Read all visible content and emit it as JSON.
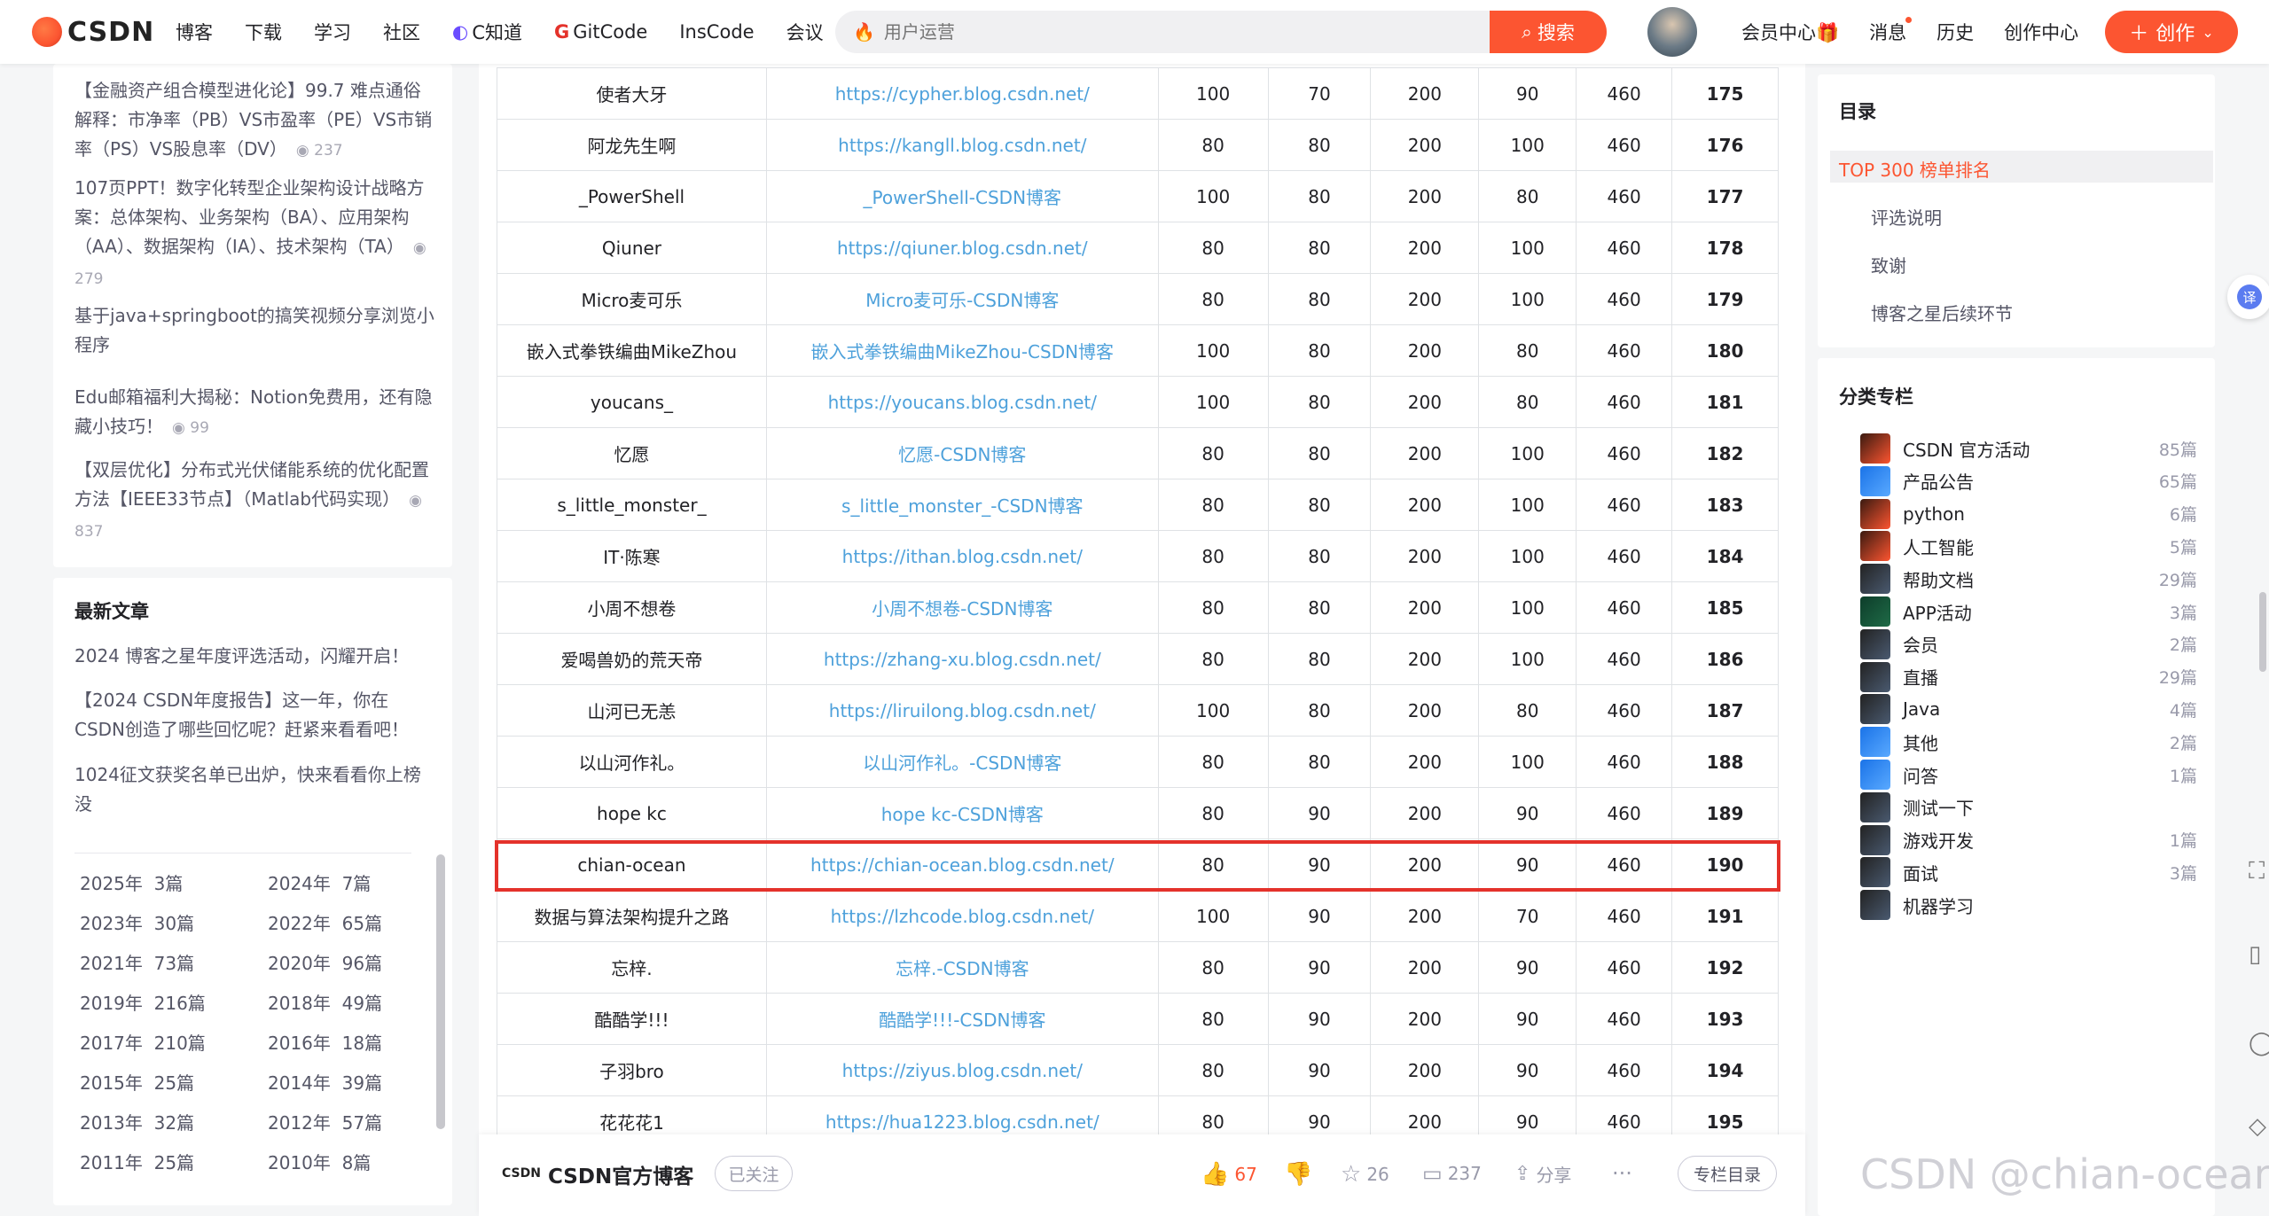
{
  "nav": {
    "logo_text": "CSDN",
    "items": [
      "博客",
      "下载",
      "学习",
      "社区",
      "C知道",
      "GitCode",
      "InsCode",
      "会议"
    ],
    "search_placeholder": "用户运营",
    "search_button": "搜索",
    "right": [
      "会员中心",
      "消息",
      "历史",
      "创作中心"
    ],
    "create": "创作"
  },
  "left": {
    "related": [
      {
        "title": "【金融资产组合模型进化论】99.7 难点通俗解释：市净率（PB）VS市盈率（PE）VS市销率（PS）VS股息率（DV）",
        "views": "237"
      },
      {
        "title": "107页PPT！数字化转型企业架构设计战略方案：总体架构、业务架构（BA）、应用架构（AA）、数据架构（IA）、技术架构（TA）",
        "views": "279"
      },
      {
        "title": "基于java+springboot的搞笑视频分享浏览小程序",
        "views": ""
      },
      {
        "title": "Edu邮箱福利大揭秘：Notion免费用，还有隐藏小技巧！",
        "views": "99"
      },
      {
        "title": "【双层优化】分布式光伏储能系统的优化配置方法【IEEE33节点】（Matlab代码实现）",
        "views": "837"
      }
    ],
    "latest_title": "最新文章",
    "latest": [
      "2024 博客之星年度评选活动，闪耀开启！",
      "【2024 CSDN年度报告】这一年，你在CSDN创造了哪些回忆呢？赶紧来看看吧！",
      "1024征文获奖名单已出炉，快来看看你上榜没"
    ],
    "archive": [
      [
        "2025年",
        "3篇"
      ],
      [
        "2024年",
        "7篇"
      ],
      [
        "2023年",
        "30篇"
      ],
      [
        "2022年",
        "65篇"
      ],
      [
        "2021年",
        "73篇"
      ],
      [
        "2020年",
        "96篇"
      ],
      [
        "2019年",
        "216篇"
      ],
      [
        "2018年",
        "49篇"
      ],
      [
        "2017年",
        "210篇"
      ],
      [
        "2016年",
        "18篇"
      ],
      [
        "2015年",
        "25篇"
      ],
      [
        "2014年",
        "39篇"
      ],
      [
        "2013年",
        "32篇"
      ],
      [
        "2012年",
        "57篇"
      ],
      [
        "2011年",
        "25篇"
      ],
      [
        "2010年",
        "8篇"
      ]
    ]
  },
  "table": {
    "rows": [
      [
        "使者大牙",
        "https://cypher.blog.csdn.net/",
        "100",
        "70",
        "200",
        "90",
        "460",
        "175"
      ],
      [
        "阿龙先生啊",
        "https://kangll.blog.csdn.net/",
        "80",
        "80",
        "200",
        "100",
        "460",
        "176"
      ],
      [
        "_PowerShell",
        "_PowerShell-CSDN博客",
        "100",
        "80",
        "200",
        "80",
        "460",
        "177"
      ],
      [
        "Qiuner",
        "https://qiuner.blog.csdn.net/",
        "80",
        "80",
        "200",
        "100",
        "460",
        "178"
      ],
      [
        "Micro麦可乐",
        "Micro麦可乐-CSDN博客",
        "80",
        "80",
        "200",
        "100",
        "460",
        "179"
      ],
      [
        "嵌入式拳铁编曲MikeZhou",
        "嵌入式拳铁编曲MikeZhou-CSDN博客",
        "100",
        "80",
        "200",
        "80",
        "460",
        "180"
      ],
      [
        "youcans_",
        "https://youcans.blog.csdn.net/",
        "100",
        "80",
        "200",
        "80",
        "460",
        "181"
      ],
      [
        "忆愿",
        "忆愿-CSDN博客",
        "80",
        "80",
        "200",
        "100",
        "460",
        "182"
      ],
      [
        "s_little_monster_",
        "s_little_monster_-CSDN博客",
        "80",
        "80",
        "200",
        "100",
        "460",
        "183"
      ],
      [
        "IT·陈寒",
        "https://ithan.blog.csdn.net/",
        "80",
        "80",
        "200",
        "100",
        "460",
        "184"
      ],
      [
        "小周不想卷",
        "小周不想卷-CSDN博客",
        "80",
        "80",
        "200",
        "100",
        "460",
        "185"
      ],
      [
        "爱喝兽奶的荒天帝",
        "https://zhang-xu.blog.csdn.net/",
        "80",
        "80",
        "200",
        "100",
        "460",
        "186"
      ],
      [
        "山河已无恙",
        "https://liruilong.blog.csdn.net/",
        "100",
        "80",
        "200",
        "80",
        "460",
        "187"
      ],
      [
        "以山河作礼。",
        "以山河作礼。-CSDN博客",
        "80",
        "80",
        "200",
        "100",
        "460",
        "188"
      ],
      [
        "hope kc",
        "hope kc-CSDN博客",
        "80",
        "90",
        "200",
        "90",
        "460",
        "189"
      ],
      [
        "chian-ocean",
        "https://chian-ocean.blog.csdn.net/",
        "80",
        "90",
        "200",
        "90",
        "460",
        "190"
      ],
      [
        "数据与算法架构提升之路",
        "https://lzhcode.blog.csdn.net/",
        "100",
        "90",
        "200",
        "70",
        "460",
        "191"
      ],
      [
        "忘梓.",
        "忘梓.-CSDN博客",
        "80",
        "90",
        "200",
        "90",
        "460",
        "192"
      ],
      [
        "酷酷学!!!",
        "酷酷学!!!-CSDN博客",
        "80",
        "90",
        "200",
        "90",
        "460",
        "193"
      ],
      [
        "子羽bro",
        "https://ziyus.blog.csdn.net/",
        "80",
        "90",
        "200",
        "90",
        "460",
        "194"
      ],
      [
        "花花花1",
        "https://hua1223.blog.csdn.net/",
        "80",
        "90",
        "200",
        "90",
        "460",
        "195"
      ]
    ]
  },
  "bottom": {
    "brand": "CSDN",
    "name": "CSDN官方博客",
    "follow": "已关注",
    "likes": "67",
    "stars": "26",
    "comments": "237",
    "share": "分享",
    "catalog": "专栏目录"
  },
  "toc": {
    "title": "目录",
    "items": [
      "TOP 300 榜单排名",
      "评选说明",
      "致谢",
      "博客之星后续环节"
    ]
  },
  "categories": {
    "title": "分类专栏",
    "items": [
      {
        "name": "CSDN 官方活动",
        "count": "85篇"
      },
      {
        "name": "产品公告",
        "count": "65篇"
      },
      {
        "name": "python",
        "count": "6篇"
      },
      {
        "name": "人工智能",
        "count": "5篇"
      },
      {
        "name": "帮助文档",
        "count": "29篇"
      },
      {
        "name": "APP活动",
        "count": "3篇"
      },
      {
        "name": "会员",
        "count": "2篇"
      },
      {
        "name": "直播",
        "count": "29篇"
      },
      {
        "name": "Java",
        "count": "4篇"
      },
      {
        "name": "其他",
        "count": "2篇"
      },
      {
        "name": "问答",
        "count": "1篇"
      },
      {
        "name": "测试一下",
        "count": ""
      },
      {
        "name": "游戏开发",
        "count": "1篇"
      },
      {
        "name": "面试",
        "count": "3篇"
      },
      {
        "name": "机器学习",
        "count": ""
      }
    ]
  },
  "watermark": "CSDN @chian-ocean"
}
